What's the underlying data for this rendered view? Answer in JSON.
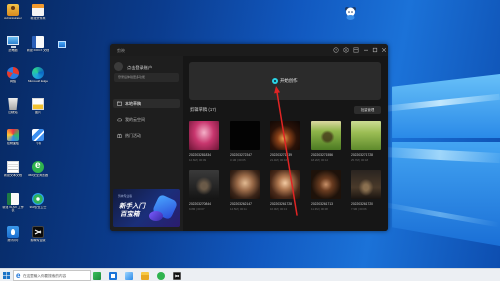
{
  "colors": {
    "accent": "#2ad4e6",
    "arrow": "#e02424"
  },
  "desktop": {
    "icons": [
      {
        "label": "Administrator",
        "icon": "user-folder-icon"
      },
      {
        "label": "新建文件夹",
        "icon": "document-folder-icon"
      },
      {
        "label": "此电脑",
        "icon": "computer-icon"
      },
      {
        "label": "新建 DOCX 文档",
        "icon": "word-document-icon"
      },
      {
        "label": "网络",
        "icon": "network-icon"
      },
      {
        "label": "Microsoft Edge",
        "icon": "edge-browser-icon"
      },
      {
        "label": "回收站",
        "icon": "recycle-bin-icon"
      },
      {
        "label": "图片",
        "icon": "image-file-icon"
      },
      {
        "label": "控制面板",
        "icon": "control-panel-icon"
      },
      {
        "label": "飞书",
        "icon": "bird-app-icon"
      },
      {
        "label": "新建文本文档",
        "icon": "text-document-icon"
      },
      {
        "label": "360安全浏览器",
        "icon": "green-browser-icon"
      },
      {
        "label": "新建 XLSX 工作表",
        "icon": "spreadsheet-icon"
      },
      {
        "label": "360安全卫士",
        "icon": "shield-icon"
      },
      {
        "label": "腾讯QQ",
        "icon": "qq-icon"
      },
      {
        "label": "剪映专业版",
        "icon": "capcut-icon"
      }
    ]
  },
  "app": {
    "title": "剪映",
    "sidebar": {
      "login_text": "点击登录账户",
      "login_tip": "登录后体验更多功能",
      "nav": [
        {
          "label": "本地草稿",
          "icon": "folder-icon"
        },
        {
          "label": "我的云空间",
          "icon": "cloud-icon"
        },
        {
          "label": "热门活动",
          "icon": "gift-icon"
        }
      ],
      "banner": {
        "caption": "剪映专业版",
        "line1": "新手入门",
        "line2": "百宝箱"
      }
    },
    "main": {
      "create_label": "开始创作",
      "drafts_title": "剪辑草稿",
      "drafts_count": "(17)",
      "manage_label": "批量管理",
      "drafts": [
        {
          "name": "202203281834",
          "meta": "12.6M | 00:09"
        },
        {
          "name": "202203272347",
          "meta": "3.1M | 00:05"
        },
        {
          "name": "202203271239",
          "meta": "21.4M | 00:16"
        },
        {
          "name": "202203271556",
          "meta": "18.2M | 00:12"
        },
        {
          "name": "202203271728",
          "meta": "25.7M | 00:18"
        },
        {
          "name": "202203270844",
          "meta": "9.8M | 00:07"
        },
        {
          "name": "202203262147",
          "meta": "14.5M | 00:11"
        },
        {
          "name": "202203261728",
          "meta": "16.0M | 00:13"
        },
        {
          "name": "202203261713",
          "meta": "11.3M | 00:08"
        },
        {
          "name": "202203261720",
          "meta": "7.9M | 00:06"
        }
      ]
    }
  },
  "taskbar": {
    "search_placeholder": "在这里输入你要搜索的内容",
    "apps": [
      {
        "icon": "photos-app-icon"
      },
      {
        "icon": "store-app-icon"
      },
      {
        "icon": "browser-app-icon"
      },
      {
        "icon": "file-explorer-icon"
      },
      {
        "icon": "green-browser-icon"
      },
      {
        "icon": "capcut-icon"
      }
    ]
  }
}
